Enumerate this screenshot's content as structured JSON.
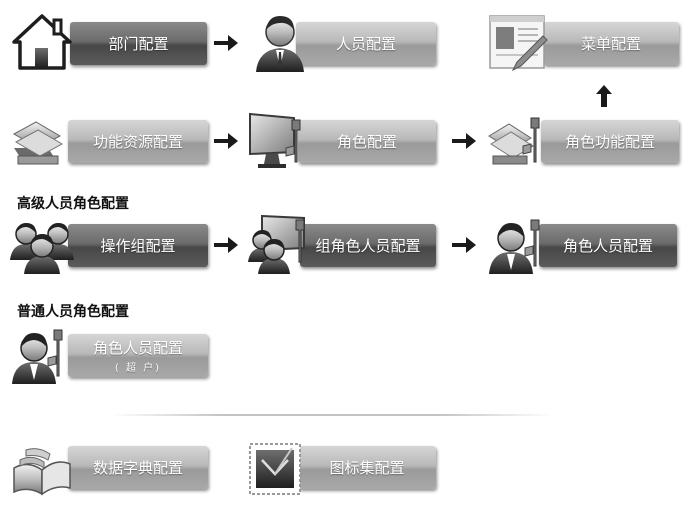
{
  "row1": {
    "dept": "部门配置",
    "person": "人员配置",
    "menu": "菜单配置"
  },
  "row2": {
    "func_resource": "功能资源配置",
    "role": "角色配置",
    "role_func": "角色功能配置"
  },
  "section_advanced": "高级人员角色配置",
  "row3": {
    "op_group": "操作组配置",
    "group_role_person": "组角色人员配置",
    "role_person": "角色人员配置"
  },
  "section_normal": "普通人员角色配置",
  "row4": {
    "role_person_super": "角色人员配置",
    "super_sub": "( 超 户)"
  },
  "row5": {
    "dictionary": "数据字典配置",
    "icon_set": "图标集配置"
  }
}
